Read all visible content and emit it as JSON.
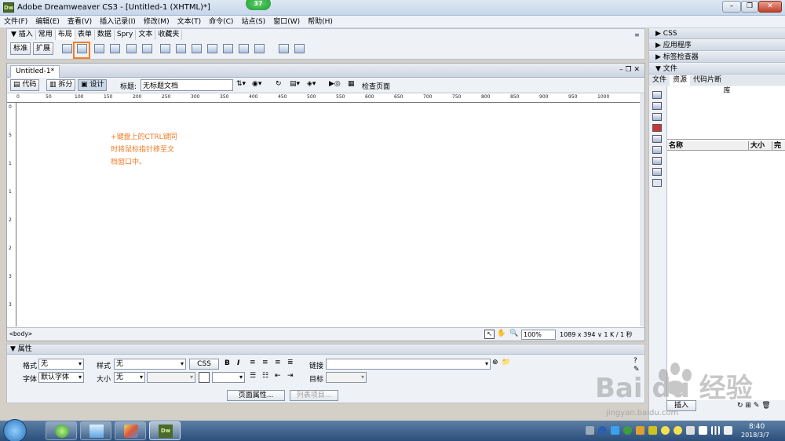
{
  "window": {
    "title": "Adobe Dreamweaver CS3 - [Untitled-1 (XHTML)*]",
    "app_icon_text": "Dw",
    "badge": "37"
  },
  "menu": [
    "文件(F)",
    "编辑(E)",
    "查看(V)",
    "插入记录(I)",
    "修改(M)",
    "文本(T)",
    "命令(C)",
    "站点(S)",
    "窗口(W)",
    "帮助(H)"
  ],
  "insert_bar": {
    "label": "▼ 插入",
    "tabs": [
      "常用",
      "布局",
      "表单",
      "数据",
      "Spry",
      "文本",
      "收藏夹"
    ],
    "active_tab": "布局",
    "mode_buttons": [
      "标准",
      "扩展"
    ]
  },
  "document": {
    "tab": "Untitled-1*",
    "view_buttons": [
      "代码",
      "拆分",
      "设计"
    ],
    "title_label": "标题:",
    "title_value": "无标题文档",
    "check_page": "检查页面",
    "ruler_ticks": [
      "0",
      "50",
      "100",
      "150",
      "200",
      "250",
      "300",
      "350",
      "400",
      "450",
      "500",
      "550",
      "600",
      "650",
      "700",
      "750",
      "800",
      "850",
      "900",
      "950",
      "1000"
    ],
    "left_ruler_ticks": [
      "0",
      "5",
      "1",
      "1",
      "2",
      "2",
      "3",
      "3"
    ],
    "note_lines": [
      "+键盘上的CTRL键同",
      "时将鼠标指针移至文",
      "档窗口中。"
    ],
    "status_tag": "<body>",
    "zoom": "100%",
    "size_info": "1089 x 394 ∨ 1 K / 1 秒"
  },
  "properties": {
    "header": "▼ 属性",
    "format_label": "格式",
    "format_value": "无",
    "style_label": "样式",
    "style_value": "无",
    "css_button": "CSS",
    "bold": "B",
    "italic": "I",
    "link_label": "链接",
    "font_label": "字体",
    "font_value": "默认字体",
    "size_label": "大小",
    "size_value": "无",
    "target_label": "目标",
    "page_props_button": "页面属性...",
    "list_item_button": "列表项目..."
  },
  "right_panels": {
    "css": "▶ CSS",
    "app": "▶ 应用程序",
    "tag_inspector": "▶ 标签检查器",
    "files": "▼ 文件",
    "files_tabs": [
      "文件",
      "资源",
      "代码片断"
    ],
    "active_files_tab": "资源",
    "library_title": "库",
    "col_name": "名称",
    "col_size": "大小",
    "col_extra": "完",
    "insert_button": "插入"
  },
  "taskbar": {
    "time": "8:40",
    "date": "2018/3/7"
  },
  "watermark": {
    "brand": "Bai du 经验",
    "url": "jingyan.baidu.com"
  },
  "colors": {
    "highlight": "#ff7b1c",
    "note_text": "#f07a24"
  }
}
